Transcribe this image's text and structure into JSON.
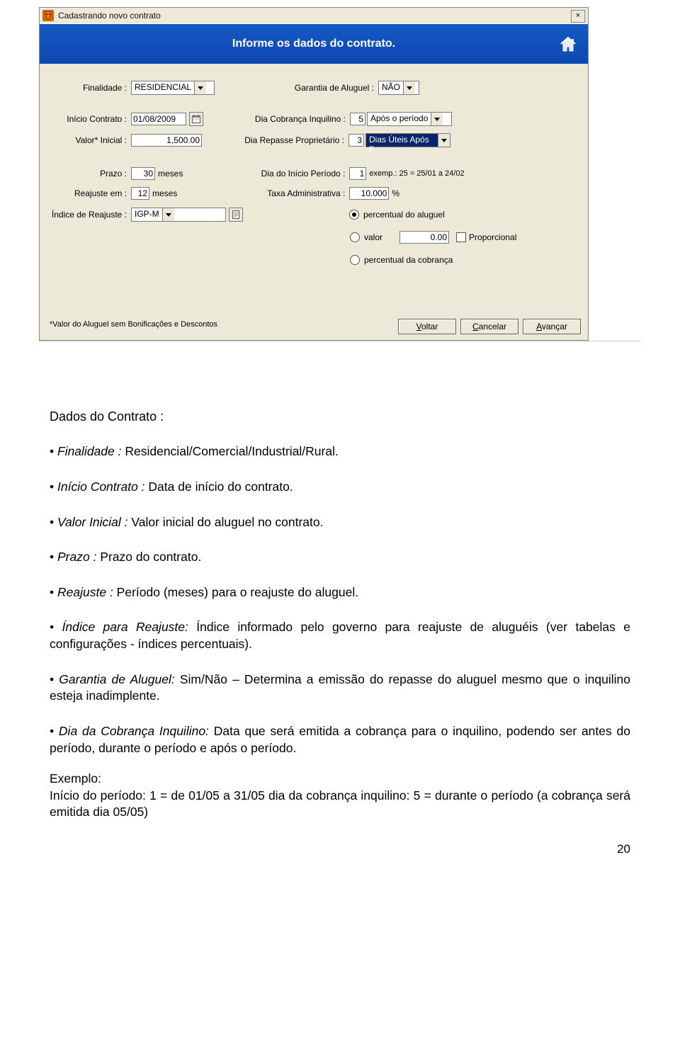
{
  "window": {
    "title": "Cadastrando novo contrato",
    "close_glyph": "×"
  },
  "banner": {
    "text": "Informe os dados do contrato."
  },
  "form": {
    "finalidade_label": "Finalidade :",
    "finalidade_value": "RESIDENCIAL",
    "garantia_label": "Garantia de Aluguel :",
    "garantia_value": "NÃO",
    "inicio_label": "Início Contrato :",
    "inicio_value": "01/08/2009",
    "dia_cobranca_label": "Dia  Cobrança Inquilino :",
    "dia_cobranca_value": "5",
    "dia_cobranca_option": "Após o período",
    "valor_label": "Valor* Inicial :",
    "valor_value": "1,500.00",
    "dia_repasse_label": "Dia Repasse Proprietário :",
    "dia_repasse_value": "3",
    "dia_repasse_option": "Dias Úteis Após F",
    "prazo_label": "Prazo :",
    "prazo_value": "30",
    "prazo_unit": "meses",
    "dia_inicio_periodo_label": "Dia do Início Período :",
    "dia_inicio_periodo_value": "1",
    "dia_inicio_periodo_hint": "exemp.: 25 = 25/01 a 24/02",
    "reajuste_em_label": "Reajuste em :",
    "reajuste_em_value": "12",
    "reajuste_em_unit": "meses",
    "taxa_admin_label": "Taxa Administrativa :",
    "taxa_admin_value": "10.000",
    "taxa_admin_unit": "%",
    "indice_label": "Índice de Reajuste :",
    "indice_value": "IGP-M",
    "radio_percentual_aluguel": "percentual do aluguel",
    "radio_valor": "valor",
    "radio_valor_amount": "0.00",
    "chk_proporcional": "Proporcional",
    "radio_percentual_cobranca": "percentual da cobrança",
    "footnote": "*Valor do Aluguel sem Bonificações e Descontos",
    "buttons": {
      "voltar": "Voltar",
      "cancelar": "Cancelar",
      "avancar": "Avançar"
    }
  },
  "doc": {
    "heading": "Dados do Contrato :",
    "items": {
      "finalidade_label": "Finalidade :",
      "finalidade_text": " Residencial/Comercial/Industrial/Rural.",
      "inicio_label": "Início Contrato :",
      "inicio_text": " Data de início do contrato.",
      "valor_label": "Valor Inicial :",
      "valor_text": " Valor inicial do aluguel no contrato.",
      "prazo_label": "Prazo :",
      "prazo_text": " Prazo do contrato.",
      "reajuste_label": "Reajuste :",
      "reajuste_text": " Período (meses) para o reajuste do aluguel.",
      "indice_label": "Índice para Reajuste:",
      "indice_text": " Índice informado pelo governo para reajuste de aluguéis (ver tabelas e configurações - índices percentuais).",
      "garantia_label": "Garantia de Aluguel:",
      "garantia_text": " Sim/Não – Determina a emissão do repasse do aluguel mesmo que o inquilino esteja inadimplente.",
      "diacob_label": "Dia da Cobrança Inquilino:",
      "diacob_text": " Data que será emitida a cobrança para o inquilino, podendo ser antes do período, durante o período e após o período.",
      "exemplo_label": "Exemplo:",
      "exemplo_text": "Início do período: 1 = de 01/05 a 31/05  dia da cobrança inquilino: 5 = durante o período (a cobrança será emitida dia 05/05)"
    },
    "page_number": "20"
  }
}
